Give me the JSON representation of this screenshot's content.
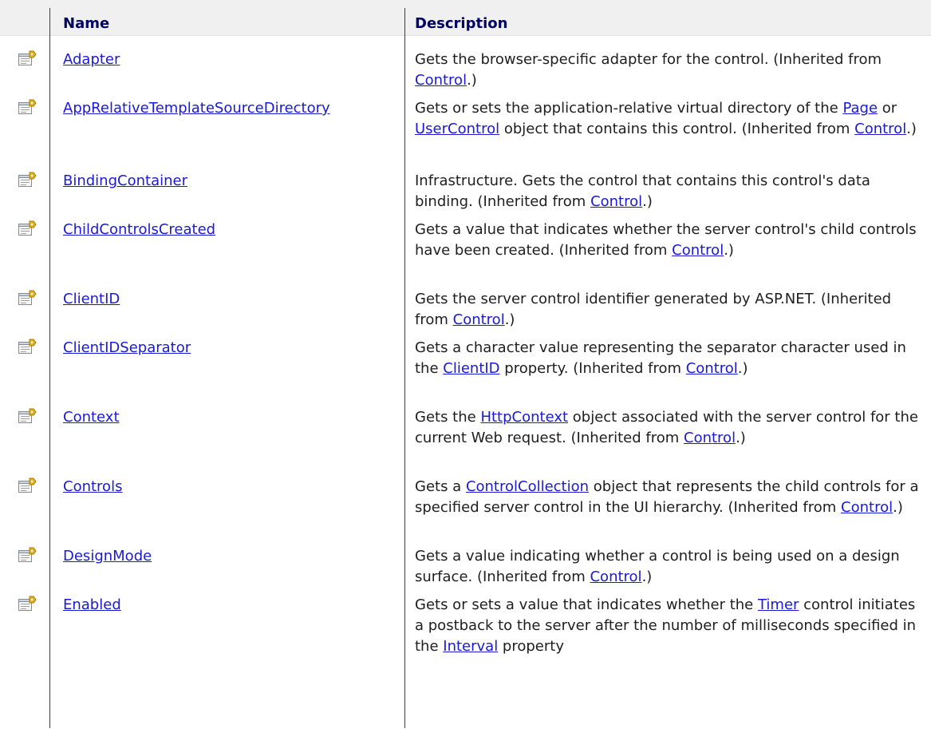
{
  "header": {
    "name": "Name",
    "description": "Description"
  },
  "properties": [
    {
      "name": "Adapter",
      "desc": [
        [
          "t",
          "Gets the browser-specific adapter for the control. (Inherited from "
        ],
        [
          "l",
          "Control"
        ],
        [
          "t",
          ".)"
        ]
      ]
    },
    {
      "name": "AppRelativeTemplateSourceDirectory",
      "desc": [
        [
          "t",
          "Gets or sets the application-relative virtual directory of the "
        ],
        [
          "l",
          "Page"
        ],
        [
          "t",
          " or "
        ],
        [
          "l",
          "UserControl"
        ],
        [
          "t",
          " object that contains this control. (Inherited from "
        ],
        [
          "l",
          "Control"
        ],
        [
          "t",
          ".)"
        ]
      ]
    },
    {
      "name": "BindingContainer",
      "desc": [
        [
          "t",
          "Infrastructure. Gets the control that contains this control's data binding. (Inherited from "
        ],
        [
          "l",
          "Control"
        ],
        [
          "t",
          ".)"
        ]
      ]
    },
    {
      "name": "ChildControlsCreated",
      "desc": [
        [
          "t",
          "Gets a value that indicates whether the server control's child controls have been created. (Inherited from "
        ],
        [
          "l",
          "Control"
        ],
        [
          "t",
          ".)"
        ]
      ]
    },
    {
      "name": "ClientID",
      "desc": [
        [
          "t",
          "Gets the server control identifier generated by ASP.NET. (Inherited from "
        ],
        [
          "l",
          "Control"
        ],
        [
          "t",
          ".)"
        ]
      ]
    },
    {
      "name": "ClientIDSeparator",
      "desc": [
        [
          "t",
          "Gets a character value representing the separator character used in the "
        ],
        [
          "l",
          "ClientID"
        ],
        [
          "t",
          " property. (Inherited from "
        ],
        [
          "l",
          "Control"
        ],
        [
          "t",
          ".)"
        ]
      ]
    },
    {
      "name": "Context",
      "desc": [
        [
          "t",
          "Gets the "
        ],
        [
          "l",
          "HttpContext"
        ],
        [
          "t",
          " object associated with the server control for the current Web request. (Inherited from "
        ],
        [
          "l",
          "Control"
        ],
        [
          "t",
          ".)"
        ]
      ]
    },
    {
      "name": "Controls",
      "desc": [
        [
          "t",
          "Gets a "
        ],
        [
          "l",
          "ControlCollection"
        ],
        [
          "t",
          " object that represents the child controls for a specified server control in the UI hierarchy. (Inherited from "
        ],
        [
          "l",
          "Control"
        ],
        [
          "t",
          ".)"
        ]
      ]
    },
    {
      "name": "DesignMode",
      "desc": [
        [
          "t",
          "Gets a value indicating whether a control is being used on a design surface. (Inherited from "
        ],
        [
          "l",
          "Control"
        ],
        [
          "t",
          ".)"
        ]
      ]
    },
    {
      "name": "Enabled",
      "desc": [
        [
          "t",
          "Gets or sets a value that indicates whether the "
        ],
        [
          "l",
          "Timer"
        ],
        [
          "t",
          " control initiates a postback to the server after the number of milliseconds specified in the "
        ],
        [
          "l",
          "Interval"
        ],
        [
          "t",
          " property"
        ]
      ]
    }
  ],
  "icons": {
    "property": "property-icon"
  },
  "colors": {
    "header_text": "#000066",
    "link": "#1a1ad6",
    "text": "#1e1e1e",
    "divider": "#3b3b3b"
  }
}
